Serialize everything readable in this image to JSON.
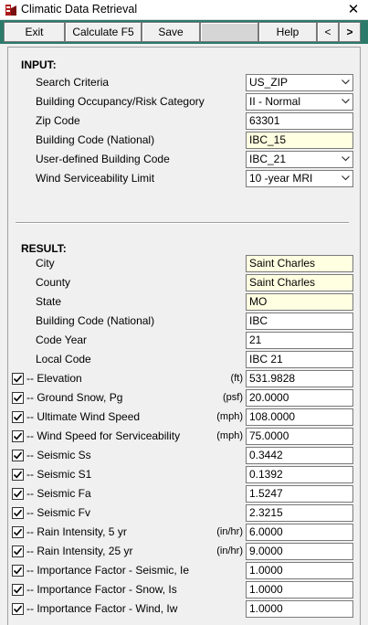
{
  "window": {
    "title": "Climatic Data Retrieval",
    "close_glyph": "✕"
  },
  "toolbar": {
    "exit": "Exit",
    "calculate": "Calculate F5",
    "save": "Save",
    "help": "Help",
    "prev": "<",
    "next": ">"
  },
  "input": {
    "heading": "INPUT:",
    "rows": [
      {
        "label": "Search Criteria",
        "value": "US_ZIP",
        "kind": "select"
      },
      {
        "label": "Building Occupancy/Risk Category",
        "value": "II - Normal",
        "kind": "select"
      },
      {
        "label": "Zip Code",
        "value": "63301",
        "kind": "text"
      },
      {
        "label": "Building Code (National)",
        "value": "IBC_15",
        "kind": "yellow"
      },
      {
        "label": "User-defined Building Code",
        "value": "IBC_21",
        "kind": "select"
      },
      {
        "label": "Wind Serviceability Limit",
        "value": "10 -year MRI",
        "kind": "select"
      }
    ]
  },
  "result": {
    "heading": "RESULT:",
    "rows": [
      {
        "label": "City",
        "value": "Saint Charles"
      },
      {
        "label": "County",
        "value": "Saint Charles"
      },
      {
        "label": "State",
        "value": "MO"
      },
      {
        "label": "Building Code (National)",
        "value": "IBC"
      },
      {
        "label": "Code Year",
        "value": "21"
      },
      {
        "label": "Local Code",
        "value": "IBC  21"
      }
    ],
    "checked_rows": [
      {
        "label": "-- Elevation",
        "unit": "(ft)",
        "value": "531.9828"
      },
      {
        "label": "-- Ground Snow, Pg",
        "unit": "(psf)",
        "value": "20.0000"
      },
      {
        "label": "-- Ultimate Wind Speed",
        "unit": "(mph)",
        "value": "108.0000"
      },
      {
        "label": "-- Wind Speed for Serviceability",
        "unit": "(mph)",
        "value": "75.0000"
      },
      {
        "label": "-- Seismic Ss",
        "unit": "",
        "value": "0.3442"
      },
      {
        "label": "-- Seismic S1",
        "unit": "",
        "value": "0.1392"
      },
      {
        "label": "-- Seismic Fa",
        "unit": "",
        "value": "1.5247"
      },
      {
        "label": "-- Seismic Fv",
        "unit": "",
        "value": "2.3215"
      },
      {
        "label": "-- Rain Intensity, 5 yr",
        "unit": "(in/hr)",
        "value": "6.0000"
      },
      {
        "label": "-- Rain Intensity, 25 yr",
        "unit": "(in/hr)",
        "value": "9.0000"
      },
      {
        "label": "-- Importance Factor - Seismic, Ie",
        "unit": "",
        "value": "1.0000"
      },
      {
        "label": "-- Importance Factor - Snow, Is",
        "unit": "",
        "value": "1.0000"
      },
      {
        "label": "-- Importance Factor - Wind, Iw",
        "unit": "",
        "value": "1.0000"
      }
    ]
  },
  "colors": {
    "toolbar": "#2c7a6a",
    "yellow_field": "#ffffe1"
  }
}
